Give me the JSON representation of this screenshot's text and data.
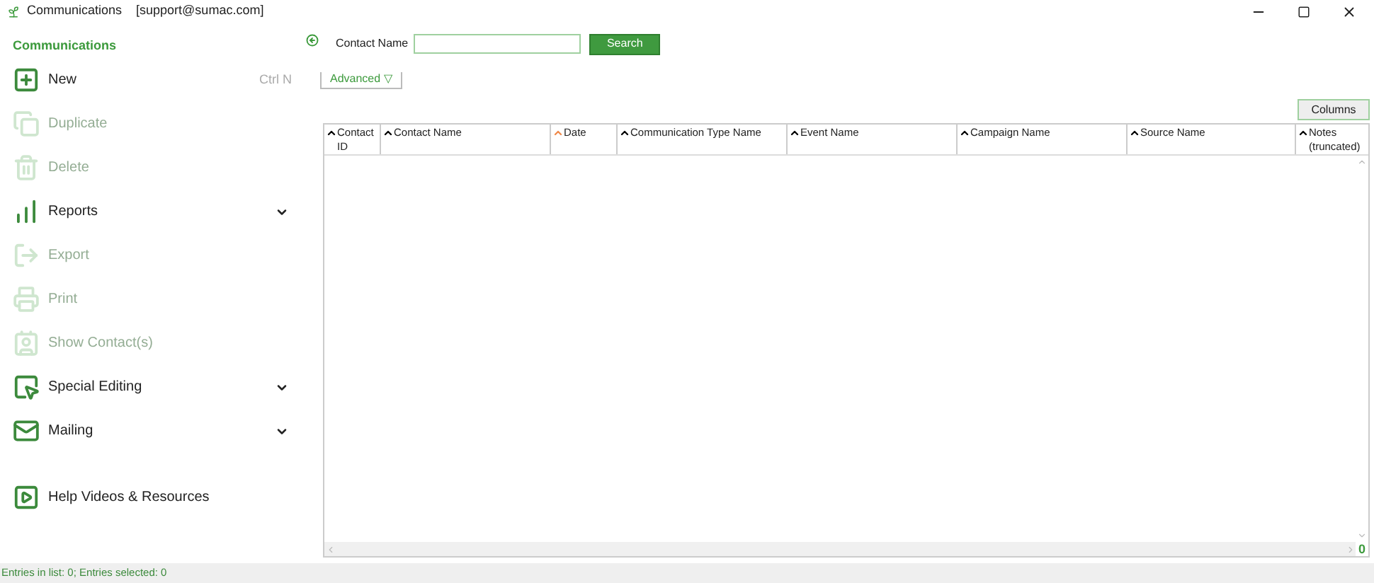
{
  "window": {
    "title": "Communications",
    "account": "[support@sumac.com]"
  },
  "sidebar": {
    "title": "Communications",
    "items": [
      {
        "label": "New",
        "shortcut": "Ctrl N",
        "disabled": false,
        "expandable": false
      },
      {
        "label": "Duplicate",
        "disabled": true,
        "expandable": false
      },
      {
        "label": "Delete",
        "disabled": true,
        "expandable": false
      },
      {
        "label": "Reports",
        "disabled": false,
        "expandable": true
      },
      {
        "label": "Export",
        "disabled": true,
        "expandable": false
      },
      {
        "label": "Print",
        "disabled": true,
        "expandable": false
      },
      {
        "label": "Show Contact(s)",
        "disabled": true,
        "expandable": false
      },
      {
        "label": "Special Editing",
        "disabled": false,
        "expandable": true
      },
      {
        "label": "Mailing",
        "disabled": false,
        "expandable": true
      },
      {
        "label": "Help Videos & Resources",
        "disabled": false,
        "expandable": false
      }
    ]
  },
  "search": {
    "label": "Contact Name",
    "button": "Search",
    "advanced": "Advanced ▽"
  },
  "columns_button": "Columns",
  "table": {
    "columns": [
      {
        "label": "Contact ID",
        "sorted": false
      },
      {
        "label": "Contact Name",
        "sorted": false
      },
      {
        "label": "Date",
        "sorted": true
      },
      {
        "label": "Communication Type Name",
        "sorted": false
      },
      {
        "label": "Event Name",
        "sorted": false
      },
      {
        "label": "Campaign Name",
        "sorted": false
      },
      {
        "label": "Source Name",
        "sorted": false
      },
      {
        "label": "Notes (truncated)",
        "sorted": false
      }
    ]
  },
  "counter": "0",
  "status_bar": "Entries in list: 0; Entries selected: 0"
}
